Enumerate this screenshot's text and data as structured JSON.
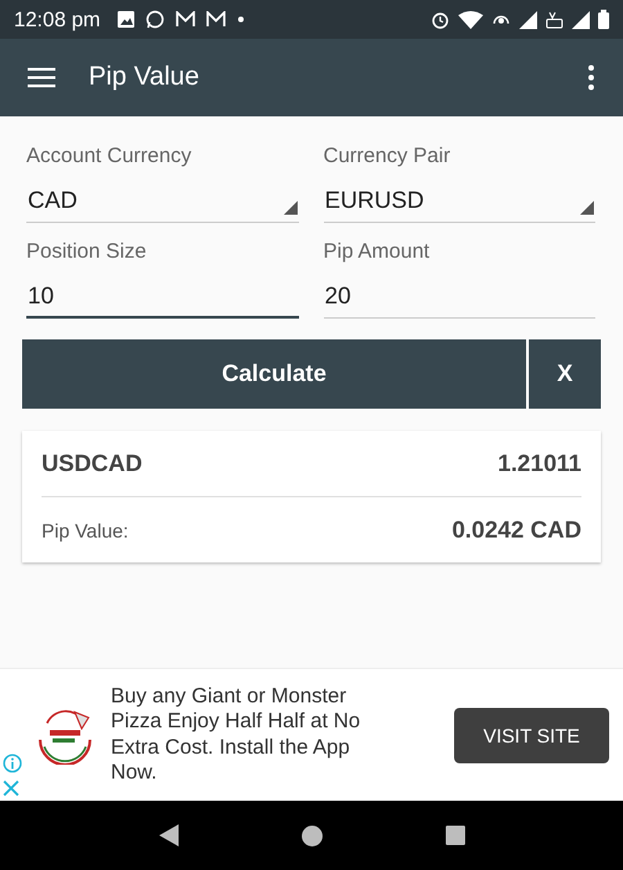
{
  "status_bar": {
    "time": "12:08 pm"
  },
  "app_bar": {
    "title": "Pip Value"
  },
  "fields": [
    {
      "label": "Account Currency",
      "value": "CAD",
      "kind": "dropdown",
      "focused": false
    },
    {
      "label": "Currency Pair",
      "value": "EURUSD",
      "kind": "dropdown",
      "focused": false
    },
    {
      "label": "Position Size",
      "value": "10",
      "kind": "input",
      "focused": true
    },
    {
      "label": "Pip Amount",
      "value": "20",
      "kind": "input",
      "focused": false
    }
  ],
  "buttons": {
    "calculate": "Calculate",
    "clear": "X"
  },
  "result": {
    "pair": "USDCAD",
    "rate": "1.21011",
    "pip_label": "Pip Value:",
    "pip_value": "0.0242 CAD"
  },
  "ad": {
    "text": "Buy any Giant or Monster Pizza Enjoy Half Half at No Extra Cost. Install the App Now.",
    "button": "VISIT SITE"
  }
}
